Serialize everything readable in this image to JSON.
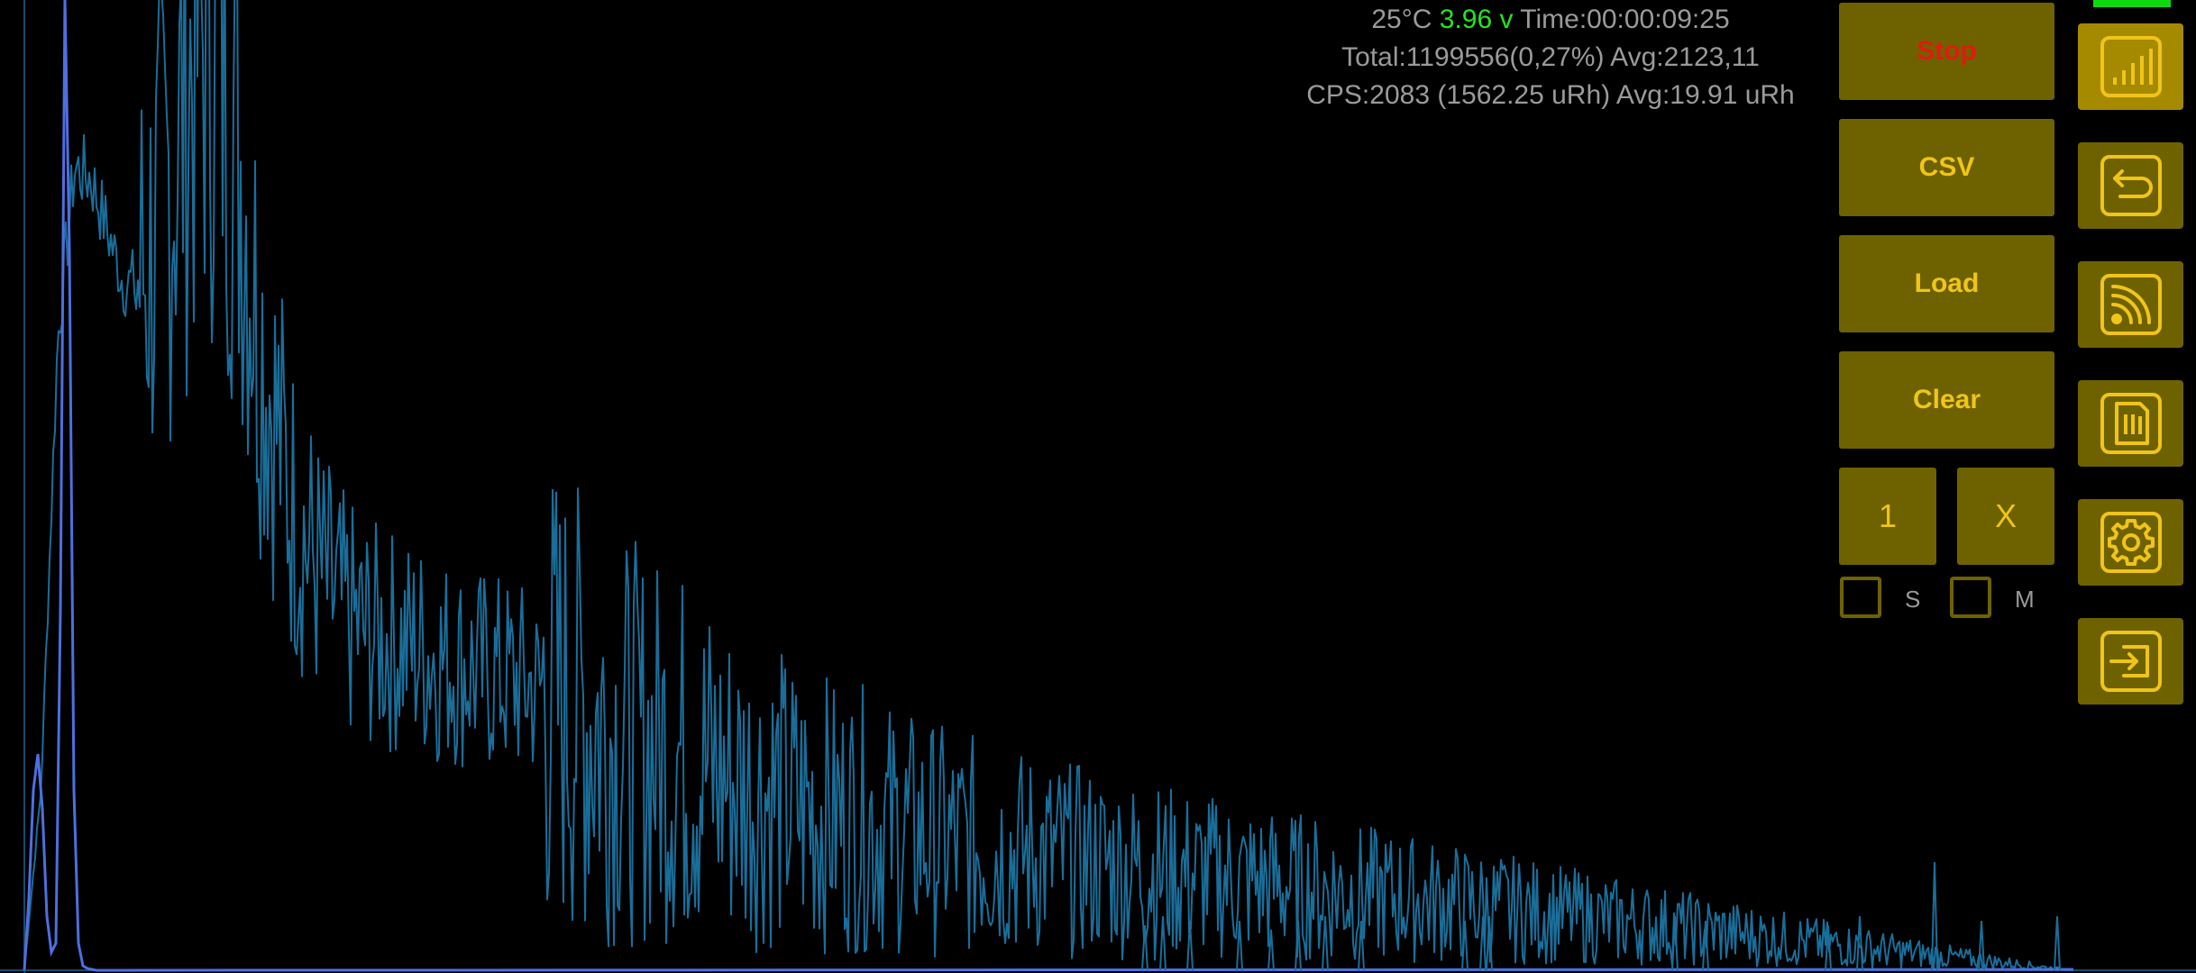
{
  "status": {
    "temperature": "25°C",
    "voltage": "3.96 v",
    "time": "Time:00:00:09:25",
    "total": "Total:1199556(0,27%) Avg:2123,11",
    "cps": "CPS:2083 (1562.25 uRh) Avg:19.91 uRh"
  },
  "controls": {
    "stop_label": "Stop",
    "csv_label": "CSV",
    "load_label": "Load",
    "clear_label": "Clear",
    "one_label": "1",
    "x_label": "X",
    "checkbox_s_label": "S",
    "checkbox_m_label": "M",
    "checkbox_s_checked": false,
    "checkbox_m_checked": false
  },
  "sidebar": {
    "items": [
      {
        "icon": "signal-bars-icon",
        "active": true
      },
      {
        "icon": "back-arrow-icon",
        "active": false
      },
      {
        "icon": "rss-feed-icon",
        "active": false
      },
      {
        "icon": "sd-card-icon",
        "active": false
      },
      {
        "icon": "gear-icon",
        "active": false
      },
      {
        "icon": "login-arrow-icon",
        "active": false
      }
    ]
  },
  "colors": {
    "spectrum": "#1a6e9a",
    "fit_curve": "#4e6fe0",
    "button_bg": "#6e6200",
    "button_text": "#f0c419",
    "stop_text": "#e01b0f",
    "voltage_text": "#22e61e",
    "status_text": "#9a9a9a",
    "battery": "#0fd80f"
  },
  "chart_data": {
    "type": "line",
    "xlabel": "",
    "ylabel": "",
    "grid": false,
    "series": [
      {
        "values": [
          0,
          200,
          700,
          890,
          880,
          820,
          760,
          770,
          820,
          900,
          1000,
          1060,
          1000,
          900,
          720,
          620,
          520,
          470,
          430,
          400,
          380,
          370,
          365,
          360,
          355,
          345,
          340,
          332,
          330,
          325,
          320,
          310,
          300,
          290,
          280,
          265,
          255,
          250,
          245,
          240,
          235,
          225,
          215,
          205,
          200,
          195,
          185,
          180,
          175,
          170,
          168,
          165,
          158,
          152,
          150,
          145,
          140,
          138,
          136,
          132,
          130,
          128,
          125,
          122,
          120,
          118,
          115,
          112,
          110,
          108,
          106,
          104,
          102,
          100,
          98,
          96,
          94,
          92,
          90,
          88,
          86,
          84,
          82,
          80,
          78,
          76,
          74,
          72,
          70,
          68,
          66,
          64,
          62,
          60,
          58,
          56,
          54,
          52,
          50,
          48,
          46,
          44,
          42,
          40,
          38,
          36,
          34,
          32,
          30,
          28,
          26,
          24,
          22,
          20,
          18,
          16,
          14,
          12,
          10,
          8,
          6,
          4,
          2,
          0
        ]
      },
      {
        "values": [
          0,
          80,
          200,
          240,
          180,
          60,
          20,
          30,
          400,
          1080,
          800,
          200,
          30,
          5,
          2,
          1,
          0
        ]
      }
    ]
  }
}
